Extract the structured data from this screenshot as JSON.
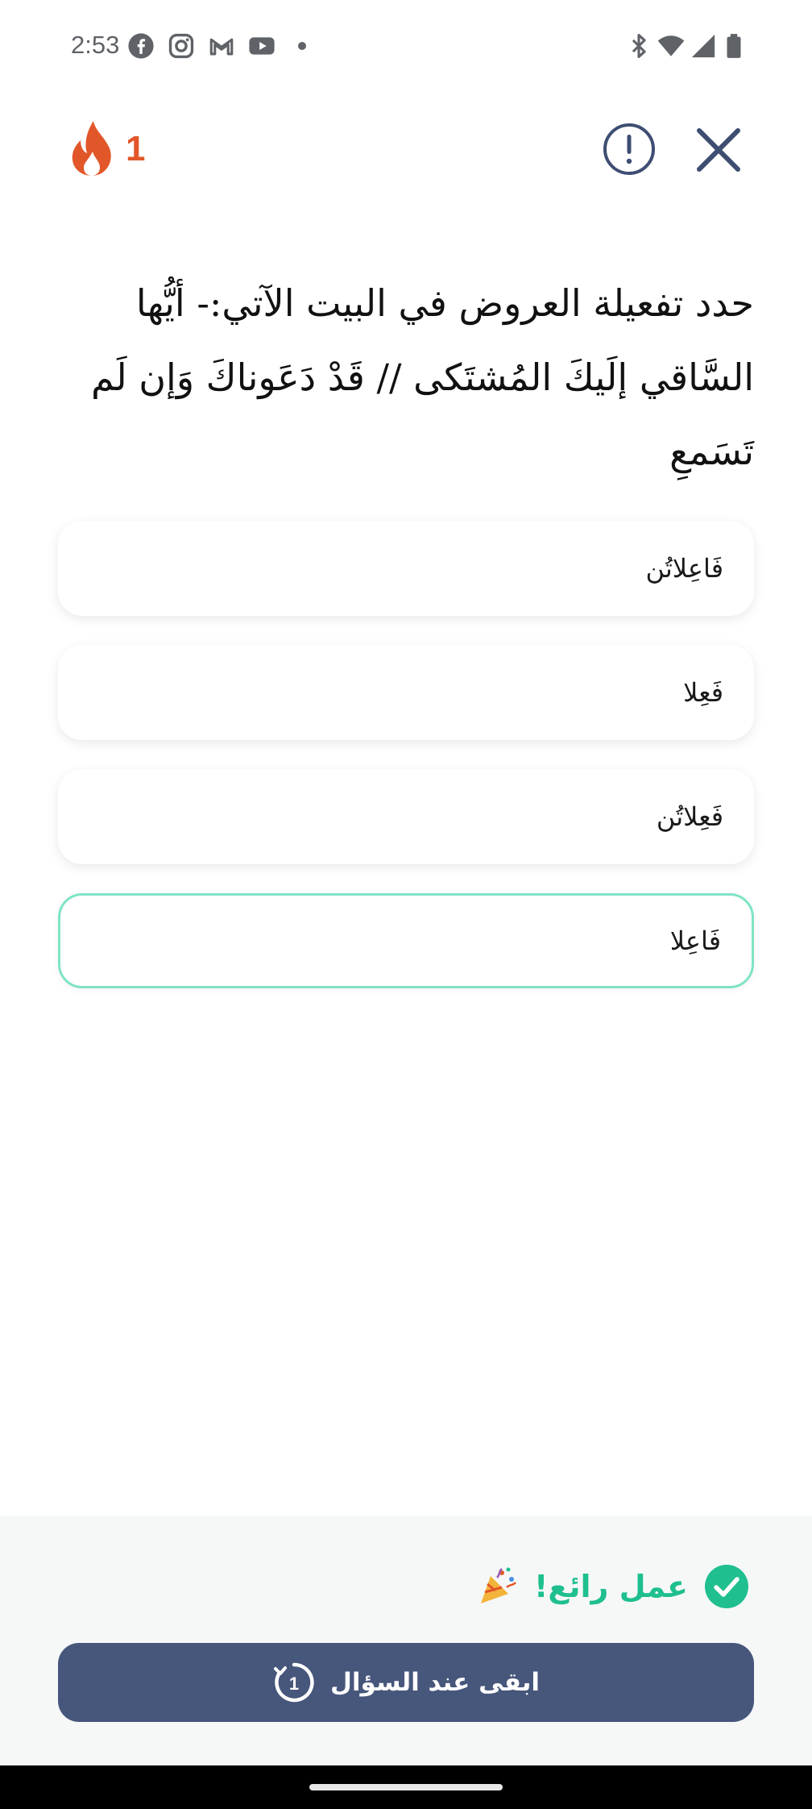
{
  "status_bar": {
    "time": "2:53",
    "icons": [
      "facebook-icon",
      "instagram-icon",
      "gmail-icon",
      "youtube-icon",
      "bluetooth-icon",
      "wifi-icon",
      "signal-icon",
      "battery-icon"
    ]
  },
  "header": {
    "streak_count": "1",
    "info_icon": "info-icon",
    "close_icon": "close-icon"
  },
  "question": {
    "text": "حدد تفعيلة العروض في البيت الآتي:- أيُّها السَّاقي إلَيكَ المُشتَكى // قَدْ دَعَوناكَ وَإن لَم تَسَمعِ"
  },
  "options": [
    {
      "label": "فَاعِلاتُن",
      "selected": false
    },
    {
      "label": "فَعِلا",
      "selected": false
    },
    {
      "label": "فَعِلاتُن",
      "selected": false
    },
    {
      "label": "فَاعِلا",
      "selected": true
    }
  ],
  "feedback": {
    "text": "عمل رائع!",
    "status_icon": "check-circle-icon",
    "emoji_icon": "party-popper-icon"
  },
  "stay_button": {
    "label": "ابقى عند السؤال",
    "badge": "1"
  },
  "colors": {
    "accent_green": "#1fbf8f",
    "selected_border": "#7fe3c6",
    "button_bg": "#47567b",
    "streak": "#e2572a",
    "icon_navy": "#3e4d72"
  }
}
